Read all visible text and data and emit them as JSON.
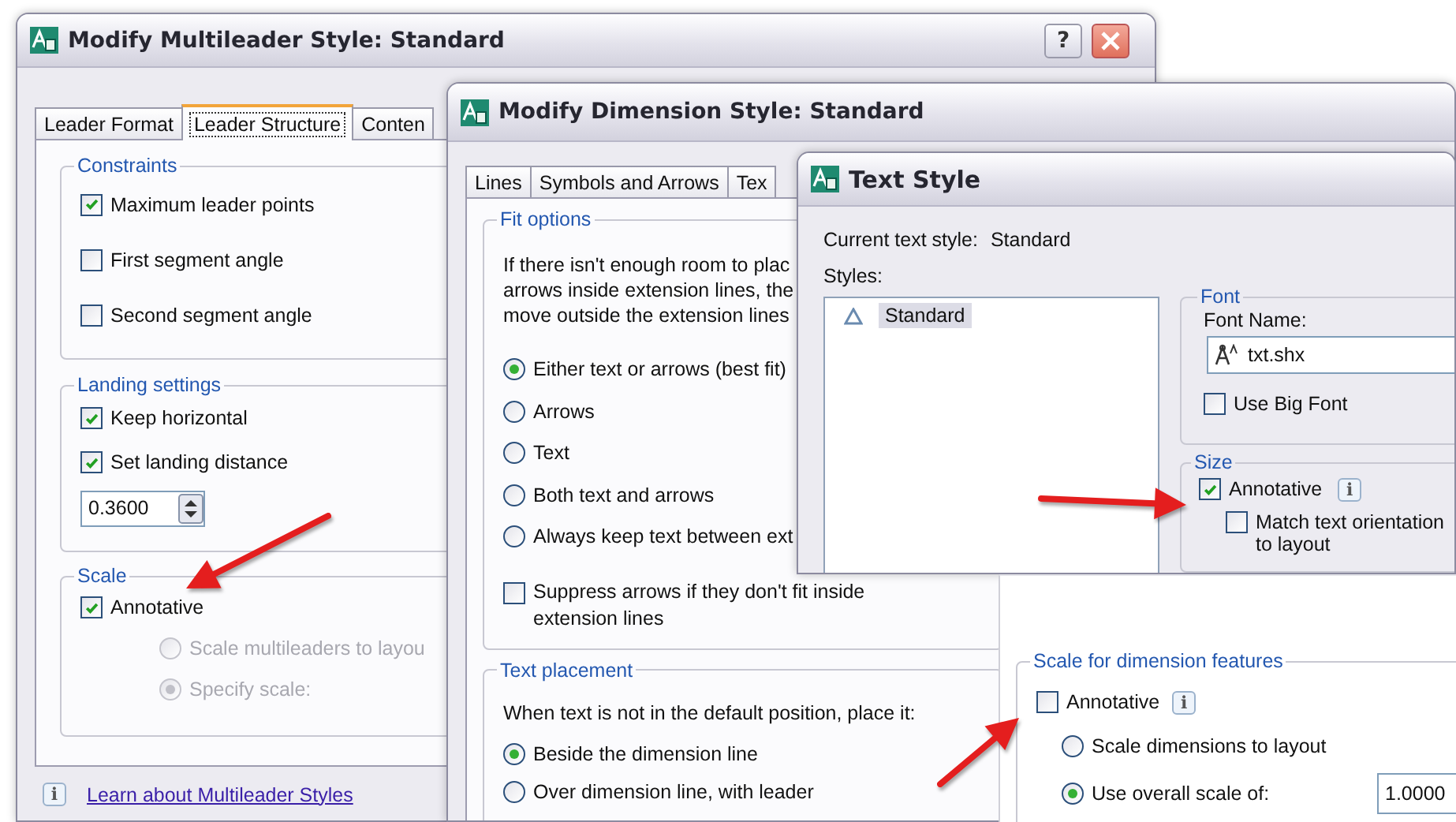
{
  "multileader_window": {
    "title": "Modify Multileader Style: Standard",
    "help_button": "?",
    "tabs": [
      {
        "label": "Leader Format",
        "selected": false
      },
      {
        "label": "Leader Structure",
        "selected": true
      },
      {
        "label": "Conten",
        "selected": false
      }
    ],
    "constraints": {
      "title": "Constraints",
      "options": [
        {
          "label": "Maximum leader points",
          "checked": true
        },
        {
          "label": "First segment angle",
          "checked": false
        },
        {
          "label": "Second segment angle",
          "checked": false
        }
      ]
    },
    "landing_settings": {
      "title": "Landing settings",
      "options": [
        {
          "label": "Keep horizontal",
          "checked": true
        },
        {
          "label": "Set landing distance",
          "checked": true
        }
      ],
      "distance": "0.3600"
    },
    "scale": {
      "title": "Scale",
      "annotative": {
        "label": "Annotative",
        "checked": true
      },
      "options": [
        {
          "label": "Scale multileaders to layou",
          "selected": false,
          "disabled": true
        },
        {
          "label": "Specify scale:",
          "selected": true,
          "disabled": true
        }
      ]
    },
    "info": "i",
    "help_link": "Learn about Multileader Styles"
  },
  "dimension_window": {
    "title": "Modify Dimension Style: Standard",
    "tabs": [
      {
        "label": "Lines",
        "selected": false
      },
      {
        "label": "Symbols and Arrows",
        "selected": false
      },
      {
        "label": "Tex",
        "selected": false
      }
    ],
    "fit_options": {
      "title": "Fit options",
      "description": [
        "If there isn't enough room to plac",
        "arrows inside extension lines, the",
        "move outside the extension lines"
      ],
      "options": [
        {
          "label": "Either text or arrows (best fit)",
          "selected": true
        },
        {
          "label": "Arrows",
          "selected": false
        },
        {
          "label": "Text",
          "selected": false
        },
        {
          "label": "Both text and arrows",
          "selected": false
        },
        {
          "label": "Always keep text between ext",
          "selected": false
        }
      ],
      "suppress": {
        "label": "Suppress arrows if they don't fit inside extension lines",
        "checked": false
      }
    },
    "text_placement": {
      "title": "Text placement",
      "description": "When text is not in the default position, place it:",
      "options": [
        {
          "label": "Beside the dimension line",
          "selected": true
        },
        {
          "label": "Over dimension line, with leader",
          "selected": false
        }
      ]
    }
  },
  "text_style_window": {
    "title": "Text Style",
    "current_label": "Current text style:",
    "current_value": "Standard",
    "styles_label": "Styles:",
    "styles": [
      {
        "name": "Standard",
        "selected": true
      }
    ],
    "font": {
      "title": "Font",
      "font_name_label": "Font Name:",
      "font_name": "txt.shx",
      "use_big_font": {
        "label": "Use Big Font",
        "checked": false
      }
    },
    "size": {
      "title": "Size",
      "annotative": {
        "label": "Annotative",
        "checked": true
      },
      "info": "i",
      "match_orientation": {
        "label": "Match text orientation to layout",
        "checked": false
      }
    }
  },
  "scale_panel": {
    "title": "Scale for dimension features",
    "annotative": {
      "label": "Annotative",
      "checked": false
    },
    "info": "i",
    "options": [
      {
        "label": "Scale dimensions to layout",
        "selected": false
      },
      {
        "label": "Use overall scale of:",
        "selected": true
      }
    ],
    "scale_value": "1.0000"
  }
}
